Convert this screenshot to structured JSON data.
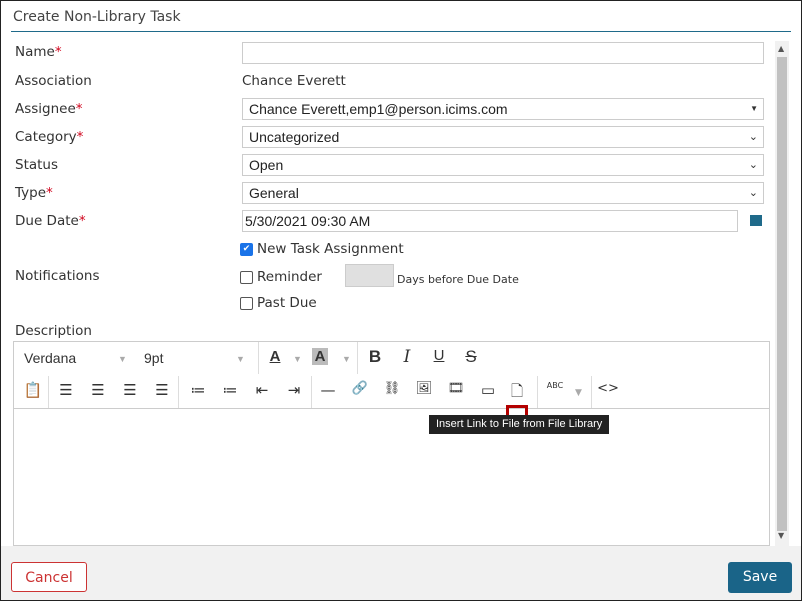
{
  "dialog": {
    "title": "Create Non-Library Task"
  },
  "form": {
    "name": {
      "label": "Name",
      "required": "*",
      "value": ""
    },
    "association": {
      "label": "Association",
      "value": "Chance Everett"
    },
    "assignee": {
      "label": "Assignee",
      "required": "*",
      "value": "Chance Everett,emp1@person.icims.com"
    },
    "category": {
      "label": "Category",
      "required": "*",
      "value": "Uncategorized"
    },
    "status": {
      "label": "Status",
      "value": "Open"
    },
    "type": {
      "label": "Type",
      "required": "*",
      "value": "General"
    },
    "due_date": {
      "label": "Due Date",
      "required": "*",
      "value": "5/30/2021 09:30 AM"
    },
    "notifications": {
      "label": "Notifications",
      "new_task_assignment": {
        "label": "New Task Assignment",
        "checked": true
      },
      "reminder": {
        "label": "Reminder",
        "checked": false,
        "days_value": "",
        "days_suffix": "Days before Due Date"
      },
      "past_due": {
        "label": "Past Due",
        "checked": false
      }
    },
    "description": {
      "label": "Description"
    }
  },
  "editor": {
    "font": "Verdana",
    "size": "9pt",
    "tooltip": "Insert Link to File from File Library",
    "icons": {
      "check": "✔",
      "chev": "⌄",
      "caret": "▼",
      "bold": "B",
      "italic": "I",
      "underline": "U",
      "strike": "S",
      "textcolor": "A",
      "hilite": "A",
      "paste": "📋",
      "hr": "—",
      "link": "🔗",
      "unlink": "⛓",
      "image": "🖼",
      "media": "🎞",
      "imgplus": "▭",
      "file": "🗋",
      "spell": "ABC",
      "code": "<>",
      "align_left": "☰",
      "align_center": "☰",
      "align_right": "☰",
      "justify": "☰",
      "ol": "≔",
      "ul": "≔",
      "outdent": "⇤",
      "indent": "⇥"
    }
  },
  "footer": {
    "cancel": "Cancel",
    "save": "Save"
  }
}
